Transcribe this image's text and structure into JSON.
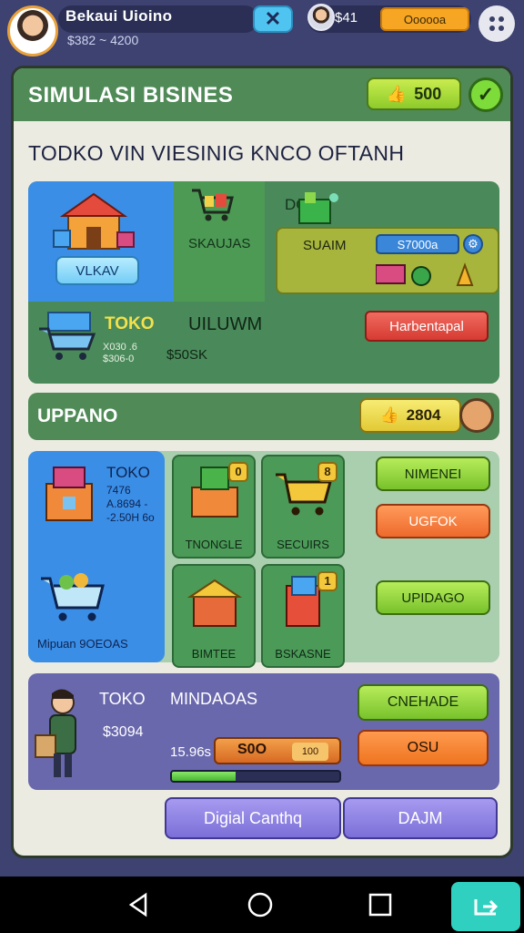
{
  "topbar": {
    "player_name": "Bekaui Uioino",
    "player_money": "$382 ~ 4200",
    "coin_value": "$41",
    "coin_tag": "Oooooa"
  },
  "panel": {
    "title": "SIMULASI BISINES",
    "badge_value": "500",
    "subtitle": "TODKO VIN VIESINIG KNCO OFTANH"
  },
  "store": {
    "left_button": "VLKAV",
    "skalwas_label": "SKAUJAS",
    "domino_label": "DOI",
    "suam_label": "SUAIM",
    "suam_tag": "S7000a",
    "toko_title": "TOKO",
    "toko_sub_line1": "X030 .6",
    "toko_sub_line2": "$306-0",
    "toko_name": "UILUWM",
    "toko_stat": "$50SK",
    "red_button": "Harbentapal"
  },
  "upgrade": {
    "title": "UPPANO",
    "badge_value": "2804"
  },
  "grid": {
    "left_title": "TOKO",
    "left_lines": "7476\nA.8694 -\n-2.50H 6o",
    "left_footer": "Mipuan 9OEOAS",
    "tiles": [
      {
        "label": "TNONGLE",
        "badge": "0"
      },
      {
        "label": "SECUIRS",
        "badge": "8"
      },
      {
        "label": "BIMTEE",
        "badge": ""
      },
      {
        "label": "BSKASNE",
        "badge": "1"
      }
    ],
    "side_buttons": [
      "NIMENEI",
      "UGFOK",
      "UPIDAGO"
    ]
  },
  "bottom": {
    "toko": "TOKO",
    "name": "MINDAOAS",
    "money": "$3094",
    "rate": "15.96s",
    "bar_value": "S0O",
    "bar_tag": "100",
    "progress": 0.38,
    "green_button": "CNEHADE",
    "orange_button": "OSU"
  },
  "footer_buttons": [
    "Digial Canthq",
    "DAJM"
  ],
  "colors": {
    "background": "#3d4270",
    "panel_header": "#4f8a57",
    "accent_blue": "#3b8ee6",
    "accent_green": "#78c22c",
    "accent_orange": "#ee6a2c",
    "accent_purple": "#7c6fd8"
  }
}
